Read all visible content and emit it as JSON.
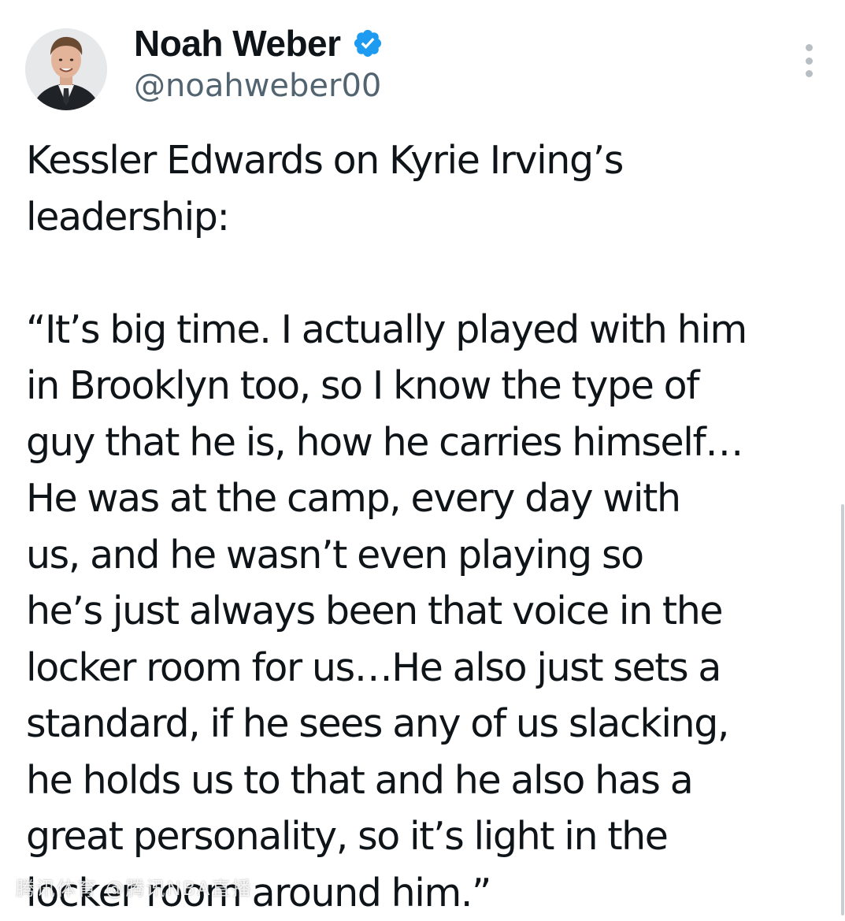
{
  "author": {
    "display_name": "Noah Weber",
    "handle": "@noahweber00",
    "verified": true,
    "avatar_icon": "profile-photo",
    "verified_icon": "verified-badge-icon"
  },
  "menu": {
    "icon": "more-options-icon"
  },
  "tweet": {
    "lines": [
      "Kessler Edwards on Kyrie Irving’s",
      "leadership:",
      "",
      "“It’s big time. I actually played with him",
      "in Brooklyn too, so I know the type of",
      "guy that he is, how he carries himself…",
      "He was at the camp, every day with",
      "us, and he wasn’t even playing so",
      "he’s just always been that voice in the",
      "locker room for us…He also just sets a",
      "standard, if he sees any of us slacking,",
      "he holds us to that and he also has a",
      "great personality, so it’s light in the",
      "locker room around him.”"
    ]
  },
  "colors": {
    "text": "#0f1419",
    "secondary_text": "#536471",
    "verified_blue": "#1d9bf0",
    "background": "#ffffff"
  },
  "watermark": {
    "text": "腾讯体育 @腾讯NBA直播"
  }
}
